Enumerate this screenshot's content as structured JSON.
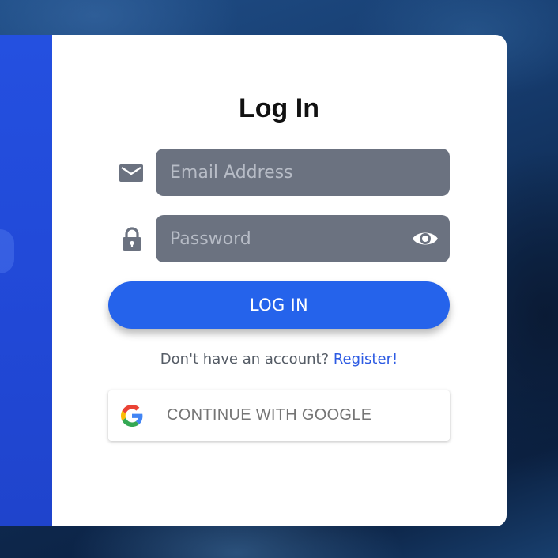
{
  "login": {
    "title": "Log In",
    "email_placeholder": "Email Address",
    "password_placeholder": "Password",
    "login_button": "LOG IN",
    "register_prompt": "Don't have an account?",
    "register_link": "Register!",
    "google_button": "CONTINUE WITH GOOGLE"
  },
  "icons": {
    "email": "envelope-icon",
    "password": "lock-icon",
    "toggle_password": "eye-icon",
    "google": "google-logo-icon"
  },
  "colors": {
    "accent": "#2563eb",
    "side_panel": "#2148d6",
    "input_bg": "#6b7280",
    "link": "#2d5be3"
  }
}
